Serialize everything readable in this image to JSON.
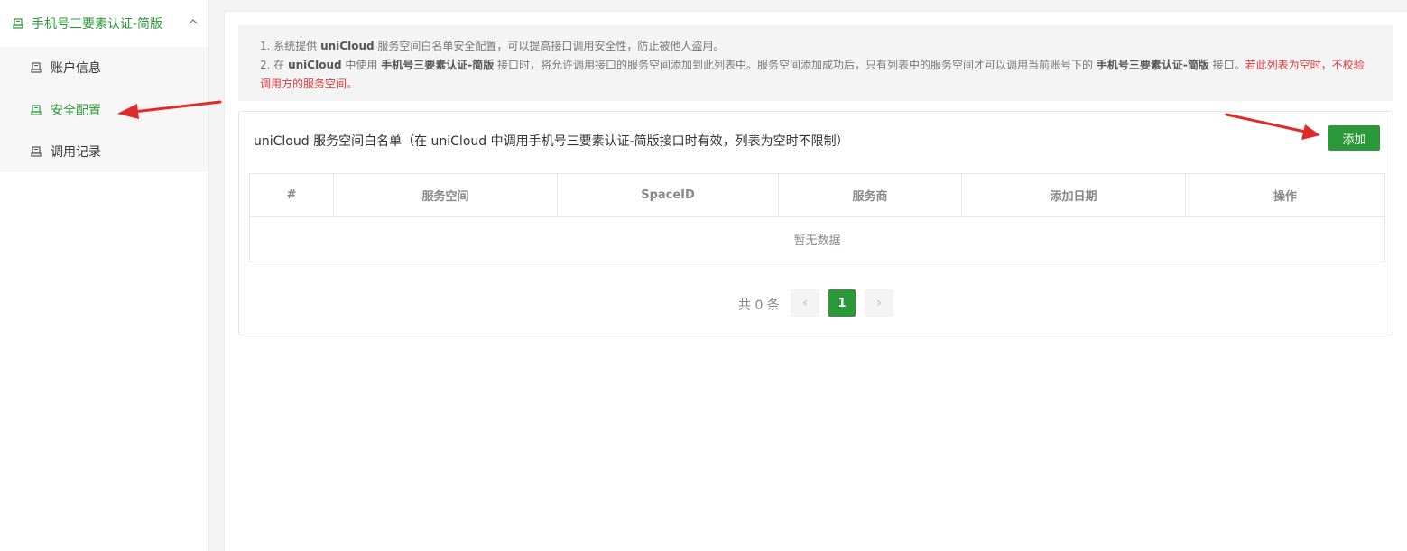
{
  "sidebar": {
    "parent_label": "手机号三要素认证-简版",
    "items": [
      {
        "label": "账户信息",
        "active": false
      },
      {
        "label": "安全配置",
        "active": true
      },
      {
        "label": "调用记录",
        "active": false
      }
    ]
  },
  "notice": {
    "line1": {
      "p1": "1. 系统提供 ",
      "b1": "uniCloud",
      "p2": " 服务空间白名单安全配置，可以提高接口调用安全性，防止被他人盗用。"
    },
    "line2": {
      "p1": "2. 在 ",
      "b1": "uniCloud",
      "p2": " 中使用 ",
      "b2": "手机号三要素认证-简版",
      "p3": " 接口时，将允许调用接口的服务空间添加到此列表中。服务空间添加成功后，只有列表中的服务空间才可以调用当前账号下的 ",
      "b3": "手机号三要素认证-简版",
      "p4": " 接口。",
      "warn": "若此列表为空时，不校验调用方的服务空间。"
    }
  },
  "panel": {
    "title": "uniCloud 服务空间白名单（在 uniCloud 中调用手机号三要素认证-简版接口时有效，列表为空时不限制）",
    "add_label": "添加"
  },
  "table": {
    "columns": [
      "#",
      "服务空间",
      "SpaceID",
      "服务商",
      "添加日期",
      "操作"
    ],
    "empty_text": "暂无数据"
  },
  "pagination": {
    "total_text": "共 0 条",
    "current_page": "1",
    "prev_glyph": "‹",
    "next_glyph": "›"
  },
  "colors": {
    "accent": "#2b9939",
    "warn": "#e0393e",
    "arrow": "#e02b2b"
  }
}
